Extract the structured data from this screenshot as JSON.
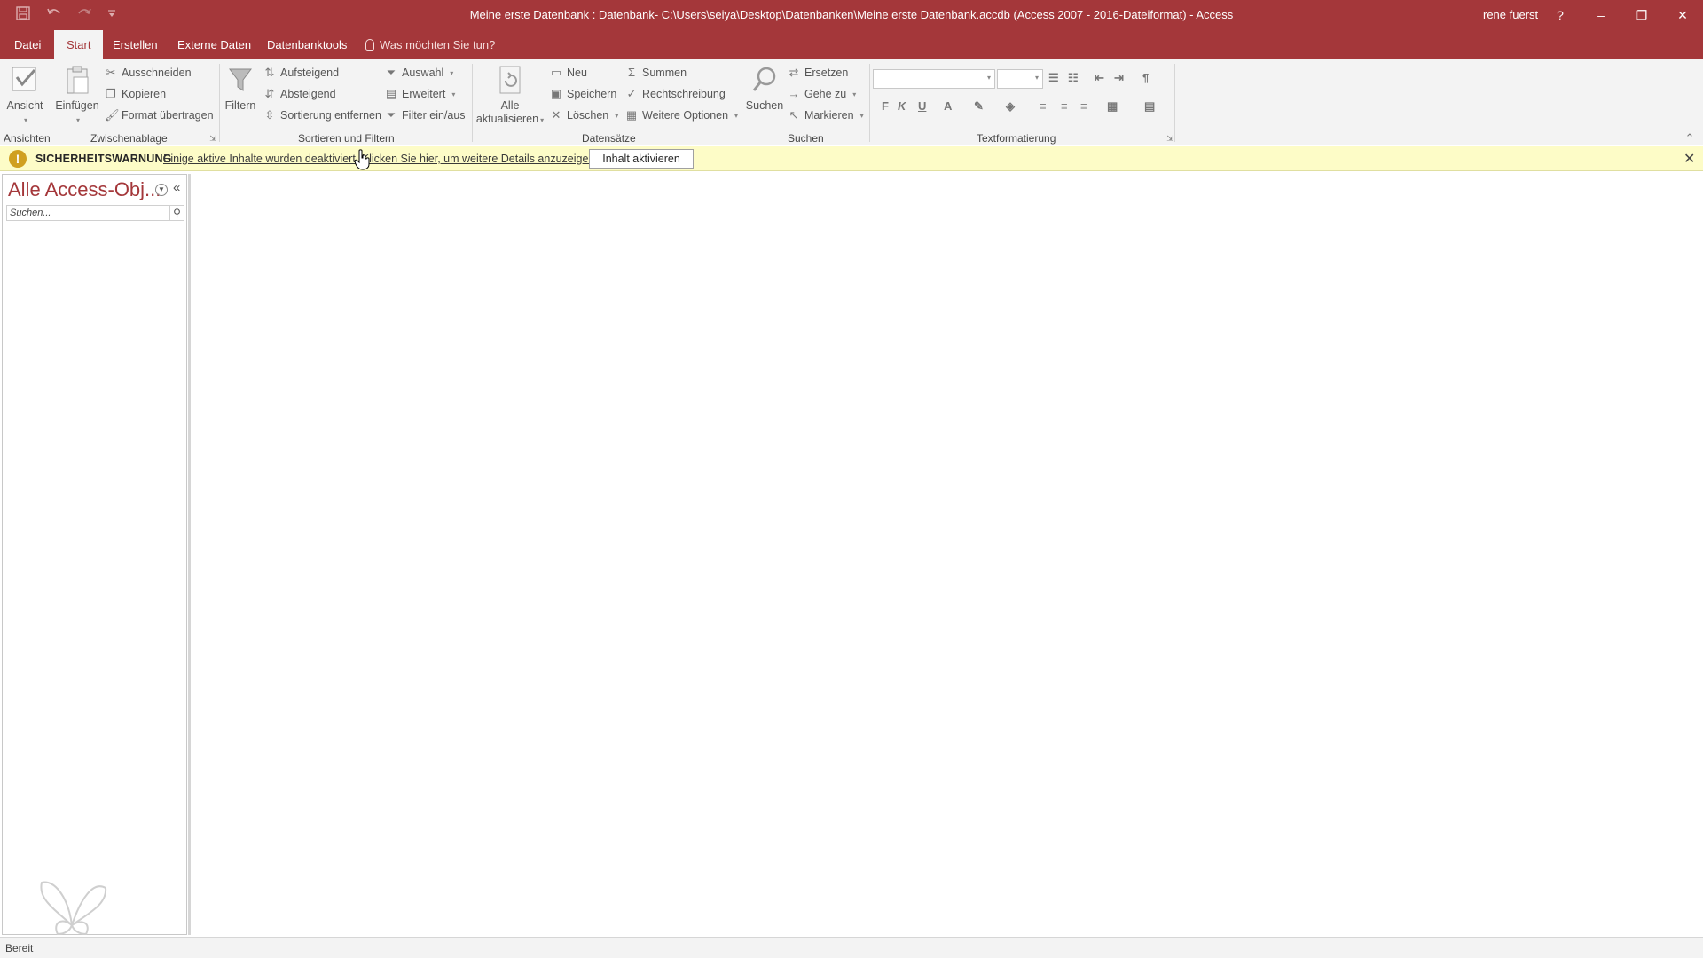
{
  "titlebar": {
    "title": "Meine erste Datenbank : Datenbank- C:\\Users\\seiya\\Desktop\\Datenbanken\\Meine erste Datenbank.accdb (Access 2007 - 2016-Dateiformat)  -  Access",
    "user": "rene fuerst",
    "help": "?",
    "minimize": "–",
    "restore": "❐",
    "close": "✕"
  },
  "tabs": {
    "datei": "Datei",
    "start": "Start",
    "erstellen": "Erstellen",
    "externe": "Externe Daten",
    "tools": "Datenbanktools",
    "tell_me": "Was möchten Sie tun?"
  },
  "ribbon": {
    "ansichten": {
      "view": "Ansicht",
      "label": "Ansichten"
    },
    "zwischenablage": {
      "paste": "Einfügen",
      "cut": "Ausschneiden",
      "copy": "Kopieren",
      "format_painter": "Format übertragen",
      "label": "Zwischenablage"
    },
    "sortieren": {
      "filter": "Filtern",
      "asc": "Aufsteigend",
      "desc": "Absteigend",
      "remove_sort": "Sortierung entfernen",
      "selection": "Auswahl",
      "advanced": "Erweitert",
      "toggle_filter": "Filter ein/aus",
      "label": "Sortieren und Filtern"
    },
    "datensaetze": {
      "refresh_all_1": "Alle",
      "refresh_all_2": "aktualisieren",
      "new": "Neu",
      "save": "Speichern",
      "delete": "Löschen",
      "totals": "Summen",
      "spelling": "Rechtschreibung",
      "more": "Weitere Optionen",
      "label": "Datensätze"
    },
    "suchen": {
      "find": "Suchen",
      "replace": "Ersetzen",
      "goto": "Gehe zu",
      "select": "Markieren",
      "label": "Suchen"
    },
    "textformatierung": {
      "bold": "F",
      "italic": "K",
      "underline": "U",
      "font_color": "A",
      "label": "Textformatierung"
    }
  },
  "security": {
    "title": "SICHERHEITSWARNUNG",
    "message": "Einige aktive Inhalte wurden deaktiviert. Klicken Sie hier, um weitere Details anzuzeigen.",
    "button": "Inhalt aktivieren"
  },
  "nav": {
    "title": "Alle Access-Obj...",
    "collapse": "«",
    "search_placeholder": "Suchen..."
  },
  "status": {
    "text": "Bereit"
  },
  "colors": {
    "accent": "#a4373a",
    "warning_bg": "#fdfcc7"
  }
}
